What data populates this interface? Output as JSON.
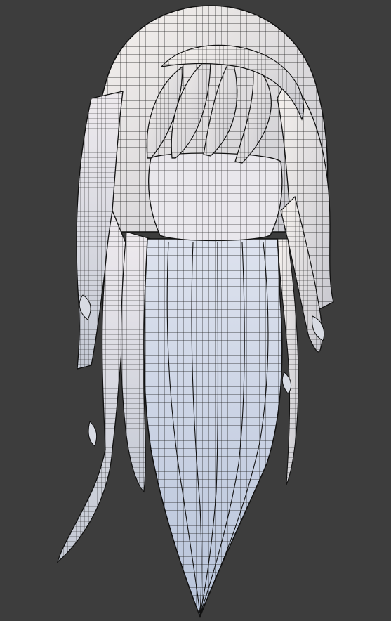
{
  "viewport": {
    "background": "#3d3d3d",
    "subject": "hair-mesh-wireframe",
    "shading": "solid-with-wireframe-overlay"
  },
  "colors": {
    "mesh_light": "#f2eef0",
    "mesh_mid": "#d9d6dc",
    "mesh_blue": "#c9d6e8",
    "mesh_shadow": "#9ea3ad",
    "wire": "#1c1c1c",
    "edge_outline": "#111111"
  }
}
